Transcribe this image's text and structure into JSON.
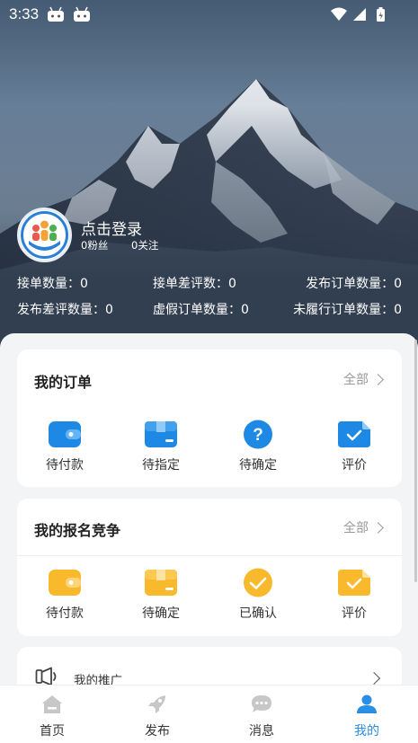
{
  "status_bar": {
    "time": "3:33"
  },
  "profile": {
    "login_text": "点击登录",
    "fans": "0粉丝",
    "follows": "0关注"
  },
  "stats": [
    {
      "label": "接单数量：0"
    },
    {
      "label": "接单差评数：0"
    },
    {
      "label": "发布订单数量：0"
    },
    {
      "label": "发布差评数量：0"
    },
    {
      "label": "虚假订单数量：0"
    },
    {
      "label": "未履行订单数量：0"
    }
  ],
  "my_orders": {
    "title": "我的订单",
    "more": "全部",
    "items": [
      {
        "label": "待付款",
        "icon": "wallet-icon"
      },
      {
        "label": "待指定",
        "icon": "box-icon"
      },
      {
        "label": "待确定",
        "icon": "question-icon"
      },
      {
        "label": "评价",
        "icon": "check-doc-icon"
      }
    ]
  },
  "my_bids": {
    "title": "我的报名竞争",
    "more": "全部",
    "items": [
      {
        "label": "待付款",
        "icon": "wallet-icon"
      },
      {
        "label": "待确定",
        "icon": "box-icon"
      },
      {
        "label": "已确认",
        "icon": "check-circle-icon"
      },
      {
        "label": "评价",
        "icon": "check-doc-icon"
      }
    ]
  },
  "promo": {
    "label": "我的推广"
  },
  "tabs": [
    {
      "label": "首页",
      "icon": "home-icon"
    },
    {
      "label": "发布",
      "icon": "rocket-icon"
    },
    {
      "label": "消息",
      "icon": "message-icon"
    },
    {
      "label": "我的",
      "icon": "user-icon",
      "active": true
    }
  ],
  "colors": {
    "blue": "#1e88e5",
    "yellow": "#f9b92c",
    "active_tab": "#2a8de6"
  }
}
